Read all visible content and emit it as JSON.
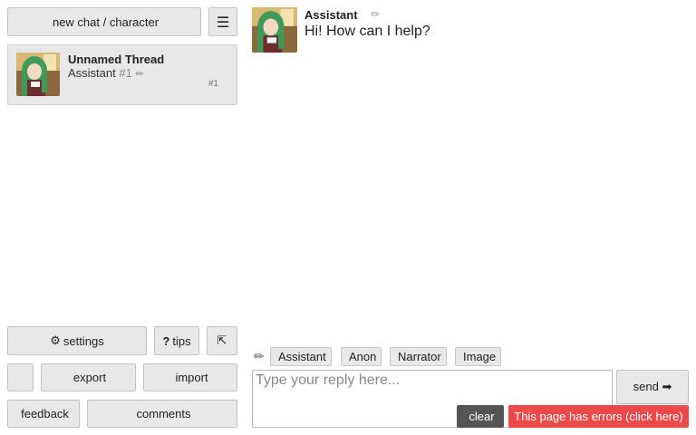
{
  "sidebar": {
    "new_chat_label": "new chat / character",
    "new_chat_icon": "",
    "menu_icon": "☰",
    "thread": {
      "title": "Unnamed Thread",
      "character": "Assistant",
      "number": "#1",
      "edit_icon": "✏",
      "side_icon_1": "",
      "side_icon_2": "",
      "side_icon_3": "",
      "count_icon": "",
      "count_label": "#1"
    },
    "settings": {
      "icon": "⚙",
      "label": "settings"
    },
    "tips": {
      "icon": "?",
      "label": "tips"
    },
    "collapse_icon": "⇱",
    "extra_icon": "",
    "export": {
      "icon": "",
      "label": "export"
    },
    "import": {
      "icon": "",
      "label": "import"
    },
    "feedback": {
      "icon": "",
      "label": "feedback"
    },
    "comments": {
      "icon": "",
      "label": "comments"
    }
  },
  "chat": {
    "messages": [
      {
        "author": "Assistant",
        "text": "Hi! How can I help?",
        "edit_icon": "✏",
        "action_icon_1": "",
        "action_icon_2": ""
      }
    ]
  },
  "composer": {
    "pencil_icon": "✏",
    "chips": [
      {
        "icon": "",
        "label": "Assistant"
      },
      {
        "icon": "",
        "label": "Anon"
      },
      {
        "icon": "",
        "label": "Narrator"
      },
      {
        "icon": "",
        "label": "Image"
      }
    ],
    "placeholder": "Type your reply here...",
    "send_label": "send ➡",
    "clear": {
      "icon": "",
      "label": "clear"
    },
    "error_label": "This page has errors (click here)"
  },
  "colors": {
    "button_bg": "#e8e8e8",
    "error_bg": "#ec4a4a",
    "clear_bg": "#555555"
  }
}
